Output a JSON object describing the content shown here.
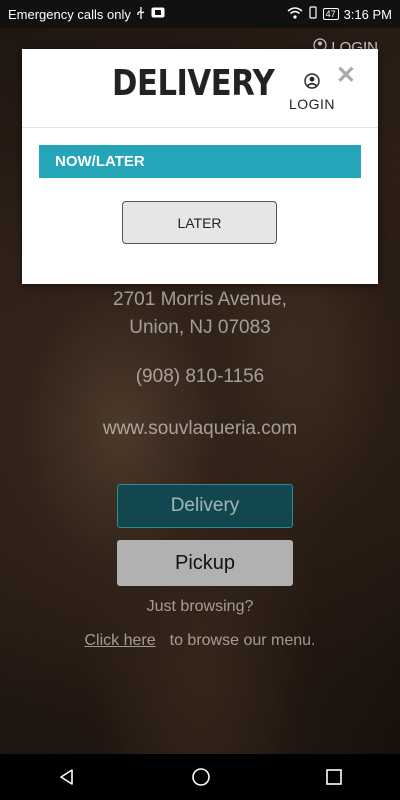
{
  "status_bar": {
    "left_text": "Emergency calls only",
    "battery": "47",
    "time": "3:16 PM"
  },
  "background": {
    "login_label": "LOGIN",
    "address_line1": "2701 Morris Avenue,",
    "address_line2": "Union, NJ 07083",
    "phone": "(908) 810-1156",
    "website": "www.souvlaqueria.com",
    "delivery_label": "Delivery",
    "pickup_label": "Pickup",
    "browsing_text": "Just browsing?",
    "click_here_label": "Click here",
    "browse_menu_text": "to browse our menu."
  },
  "modal": {
    "title": "DELIVERY",
    "login_label": "LOGIN",
    "close_symbol": "✕",
    "section_label": "NOW/LATER",
    "later_label": "LATER"
  },
  "colors": {
    "accent": "#24a6b8",
    "delivery_button": "#13474f"
  },
  "icons": [
    "usb-icon",
    "sim-icon",
    "wifi-icon",
    "vibrate-icon",
    "battery-icon",
    "user-icon",
    "close-icon",
    "back-icon",
    "home-icon",
    "recents-icon"
  ]
}
